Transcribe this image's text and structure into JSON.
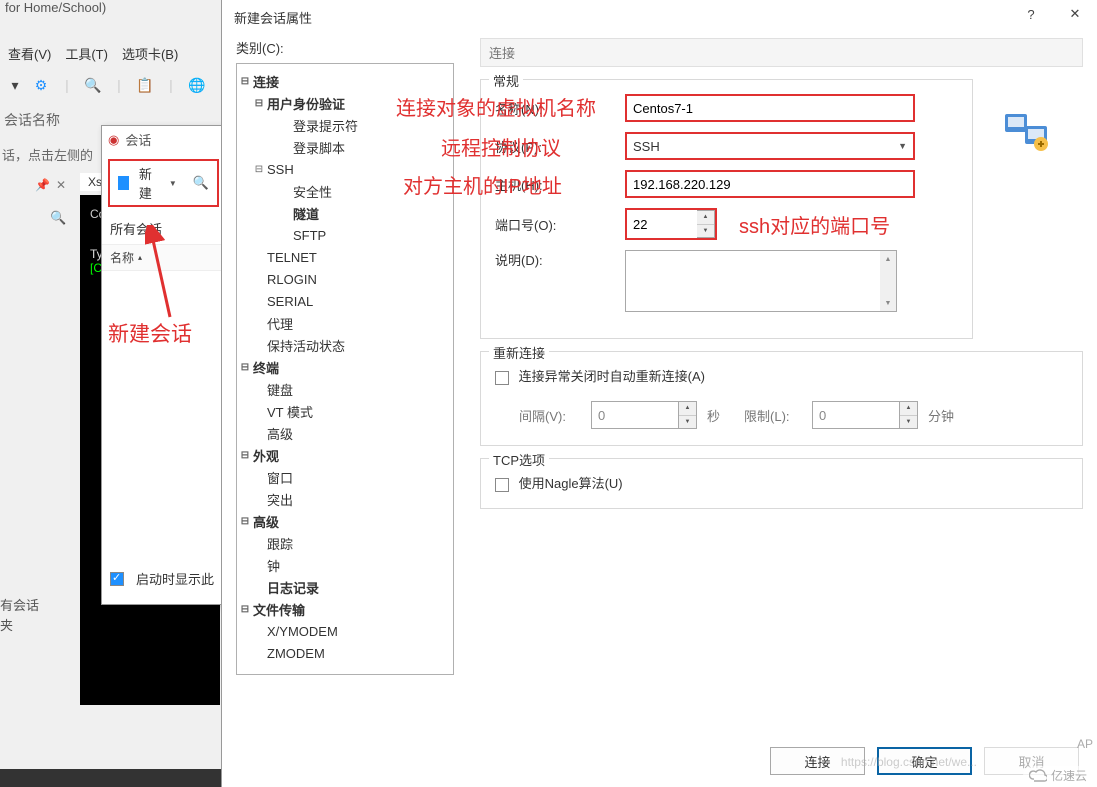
{
  "bg": {
    "title_suffix": "for Home/School)",
    "menu": [
      "查看(V)",
      "工具(T)",
      "选项卡(B)"
    ],
    "session_name_hint": "会话名称",
    "hint_line": "话，点击左侧的",
    "left1": "有会话",
    "left2": "夹",
    "term_tab": "Xsl",
    "term_copy": "Cop",
    "term_line1": "Typ",
    "term_line2": "[C"
  },
  "sess_popup": {
    "header": "会话",
    "new_label": "新建",
    "all_sessions": "所有会话",
    "col_name": "名称",
    "startup_show": "启动时显示此"
  },
  "annotation": {
    "new_session": "新建会话",
    "name_hint": "连接对象的虚拟机名称",
    "protocol_hint": "远程控制协议",
    "host_hint": "对方主机的IP地址",
    "port_hint": "ssh对应的端口号"
  },
  "dialog": {
    "title": "新建会话属性",
    "help_btn": "?",
    "close_btn": "✕",
    "category_label": "类别(C):",
    "panel_title": "连接",
    "tree": [
      {
        "d": 0,
        "exp": "⊟",
        "label": "连接",
        "bold": true
      },
      {
        "d": 1,
        "exp": "⊟",
        "label": "用户身份验证",
        "bold": true
      },
      {
        "d": 2,
        "exp": "",
        "label": "登录提示符"
      },
      {
        "d": 2,
        "exp": "",
        "label": "登录脚本"
      },
      {
        "d": 1,
        "exp": "⊟",
        "label": "SSH"
      },
      {
        "d": 2,
        "exp": "",
        "label": "安全性"
      },
      {
        "d": 2,
        "exp": "",
        "label": "隧道",
        "bold": true
      },
      {
        "d": 2,
        "exp": "",
        "label": "SFTP"
      },
      {
        "d": 1,
        "exp": "",
        "label": "TELNET"
      },
      {
        "d": 1,
        "exp": "",
        "label": "RLOGIN"
      },
      {
        "d": 1,
        "exp": "",
        "label": "SERIAL"
      },
      {
        "d": 1,
        "exp": "",
        "label": "代理"
      },
      {
        "d": 1,
        "exp": "",
        "label": "保持活动状态"
      },
      {
        "d": 0,
        "exp": "⊟",
        "label": "终端",
        "bold": true
      },
      {
        "d": 1,
        "exp": "",
        "label": "键盘"
      },
      {
        "d": 1,
        "exp": "",
        "label": "VT 模式"
      },
      {
        "d": 1,
        "exp": "",
        "label": "高级"
      },
      {
        "d": 0,
        "exp": "⊟",
        "label": "外观",
        "bold": true
      },
      {
        "d": 1,
        "exp": "",
        "label": "窗口"
      },
      {
        "d": 1,
        "exp": "",
        "label": "突出"
      },
      {
        "d": 0,
        "exp": "⊟",
        "label": "高级",
        "bold": true
      },
      {
        "d": 1,
        "exp": "",
        "label": "跟踪"
      },
      {
        "d": 1,
        "exp": "",
        "label": "钟"
      },
      {
        "d": 1,
        "exp": "",
        "label": "日志记录",
        "bold": true
      },
      {
        "d": 0,
        "exp": "⊟",
        "label": "文件传输",
        "bold": true
      },
      {
        "d": 1,
        "exp": "",
        "label": "X/YMODEM"
      },
      {
        "d": 1,
        "exp": "",
        "label": "ZMODEM"
      }
    ],
    "general": {
      "legend": "常规",
      "name_label": "名称(N):",
      "name_value": "Centos7-1",
      "protocol_label": "协议(P):",
      "protocol_value": "SSH",
      "host_label": "主机(H):",
      "host_value": "192.168.220.129",
      "port_label": "端口号(O):",
      "port_value": "22",
      "desc_label": "说明(D):"
    },
    "reconnect": {
      "legend": "重新连接",
      "checkbox": "连接异常关闭时自动重新连接(A)",
      "interval_label": "间隔(V):",
      "interval_value": "0",
      "interval_unit": "秒",
      "limit_label": "限制(L):",
      "limit_value": "0",
      "limit_unit": "分钟"
    },
    "tcp": {
      "legend": "TCP选项",
      "nagle": "使用Nagle算法(U)"
    },
    "btn_connect": "连接",
    "btn_ok": "确定",
    "btn_cancel": "取消"
  },
  "watermarks": {
    "blog": "https://blog.csdn.net/we...",
    "brand": "亿速云",
    "ap": "AP"
  }
}
